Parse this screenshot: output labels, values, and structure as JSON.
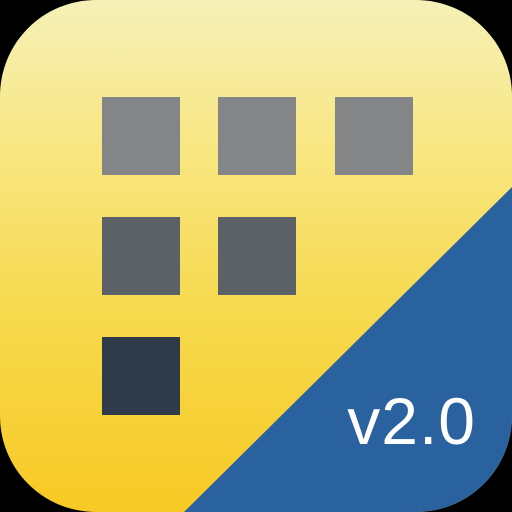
{
  "app_icon": {
    "version_label": "v2.0",
    "tile_rows": [
      3,
      2,
      1
    ],
    "colors": {
      "background_top": "#f6f0b8",
      "background_bottom": "#f8c924",
      "corner_band": "#2a62a0",
      "tile_row_1": "#848587",
      "tile_row_2": "#5c6067",
      "tile_row_3": "#2f3b48",
      "version_text": "#ffffff"
    }
  }
}
